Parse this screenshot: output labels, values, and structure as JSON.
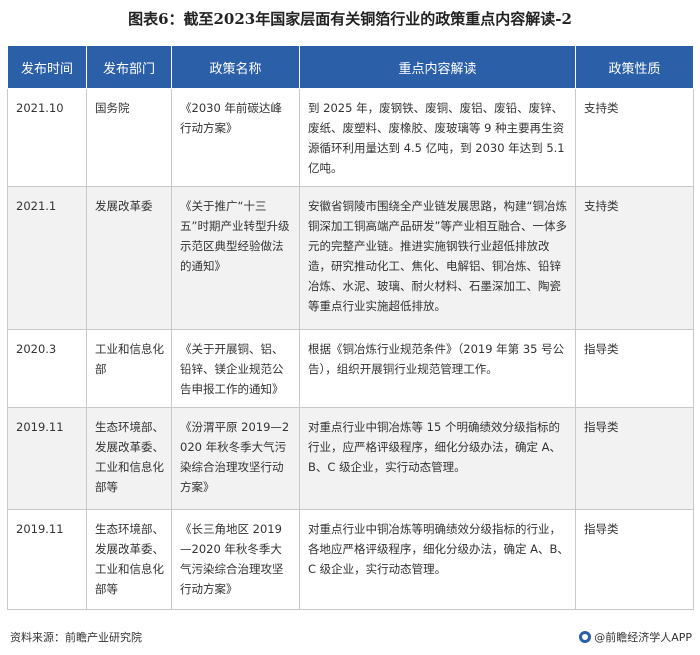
{
  "title": "图表6：截至2023年国家层面有关铜箔行业的政策重点内容解读-2",
  "table": {
    "headers": [
      "发布时间",
      "发布部门",
      "政策名称",
      "重点内容解读",
      "政策性质"
    ],
    "rows": [
      {
        "time": "2021.10",
        "dept": "国务院",
        "name": "《2030 年前碳达峰行动方案》",
        "content": "到 2025 年，废钢铁、废铜、废铝、废铅、废锌、废纸、废塑料、废橡胶、废玻璃等 9 种主要再生资源循环利用量达到 4.5 亿吨，到 2030 年达到 5.1 亿吨。",
        "nature": "支持类"
      },
      {
        "time": "2021.1",
        "dept": "发展改革委",
        "name": "《关于推广“十三五”时期产业转型升级示范区典型经验做法的通知》",
        "content": "安徽省铜陵市围绕全产业链发展思路，构建“铜冶炼铜深加工铜高端产品研发”等产业相互融合、一体多元的完整产业链。推进实施钢铁行业超低排放改造，研究推动化工、焦化、电解铝、铜冶炼、铅锌冶炼、水泥、玻璃、耐火材料、石墨深加工、陶瓷等重点行业实施超低排放。",
        "nature": "支持类"
      },
      {
        "time": "2020.3",
        "dept": "工业和信息化部",
        "name": "《关于开展铜、铝、铅锌、镁企业规范公告申报工作的通知》",
        "content": "根据《铜冶炼行业规范条件》（2019 年第 35 号公告），组织开展铜行业规范管理工作。",
        "nature": "指导类"
      },
      {
        "time": "2019.11",
        "dept": "生态环境部、发展改革委、工业和信息化部等",
        "name": "《汾渭平原 2019—2020 年秋冬季大气污染综合治理攻坚行动方案》",
        "content": "对重点行业中铜冶炼等 15 个明确绩效分级指标的行业，应严格评级程序，细化分级办法，确定 A、B、C 级企业，实行动态管理。",
        "nature": "指导类"
      },
      {
        "time": "2019.11",
        "dept": "生态环境部、发展改革委、工业和信息化部等",
        "name": "《长三角地区 2019—2020 年秋冬季大气污染综合治理攻坚行动方案》",
        "content": "对重点行业中铜冶炼等明确绩效分级指标的行业，各地应严格评级程序，细化分级办法，确定 A、B、C 级企业，实行动态管理。",
        "nature": "指导类"
      }
    ]
  },
  "footer": {
    "source": "资料来源：前瞻产业研究院",
    "brand": "@前瞻经济学人APP"
  }
}
